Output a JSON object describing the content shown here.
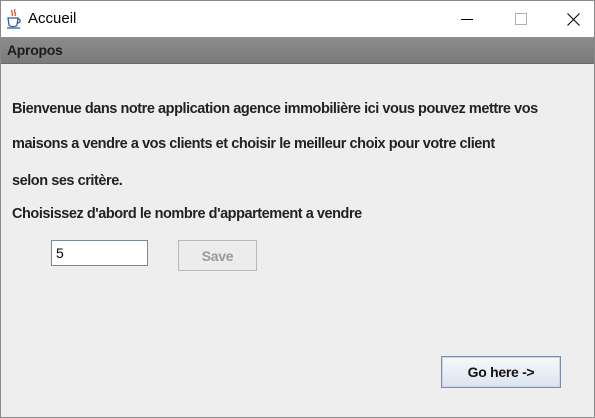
{
  "window": {
    "title": "Accueil",
    "icon": "java-coffee-cup-icon",
    "controls": [
      "minimize-icon",
      "maximize-icon",
      "close-icon"
    ]
  },
  "menubar": {
    "items": [
      {
        "label": "Apropos"
      }
    ]
  },
  "content": {
    "lines": [
      "Bienvenue dans notre application agence immobilière ici vous pouvez mettre vos",
      "maisons a vendre a vos clients et choisir le meilleur choix pour votre client",
      "selon ses critère.",
      "Choisissez d'abord le nombre d'appartement a vendre"
    ],
    "count_value": "5",
    "save_label": "Save",
    "go_label": "Go here ->"
  },
  "colors": {
    "menubar": "#8c8c8c",
    "window_background": "#eeeeee",
    "save_text_disabled": "#9a9a9a"
  }
}
